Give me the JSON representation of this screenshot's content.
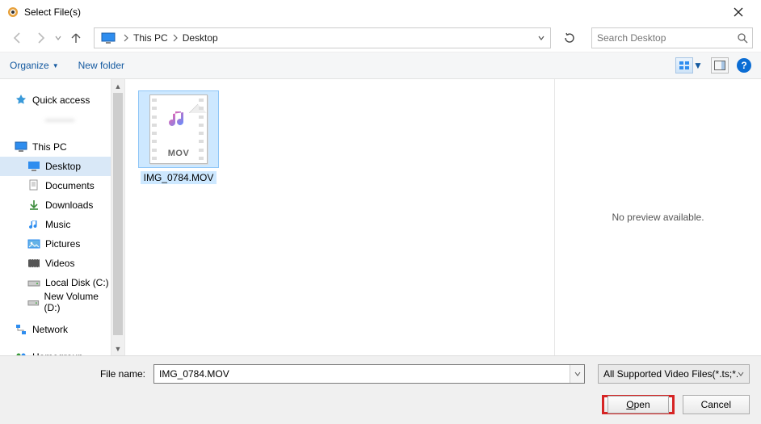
{
  "title": "Select File(s)",
  "breadcrumb": {
    "item0": "This PC",
    "item1": "Desktop"
  },
  "search": {
    "placeholder": "Search Desktop"
  },
  "toolbar": {
    "organize": "Organize",
    "new_folder": "New folder"
  },
  "sidebar": {
    "quick_access": "Quick access",
    "blurred": "———",
    "this_pc": "This PC",
    "desktop": "Desktop",
    "documents": "Documents",
    "downloads": "Downloads",
    "music": "Music",
    "pictures": "Pictures",
    "videos": "Videos",
    "local_disk": "Local Disk (C:)",
    "new_volume": "New Volume (D:)",
    "network": "Network",
    "homegroup": "Homegroup"
  },
  "file": {
    "name": "IMG_0784.MOV",
    "ext_label": "MOV"
  },
  "preview": {
    "text": "No preview available."
  },
  "bottom": {
    "filename_label": "File name:",
    "filename_value": "IMG_0784.MOV",
    "filter": "All Supported Video Files(*.ts;*.",
    "open": "Open",
    "cancel": "Cancel"
  }
}
